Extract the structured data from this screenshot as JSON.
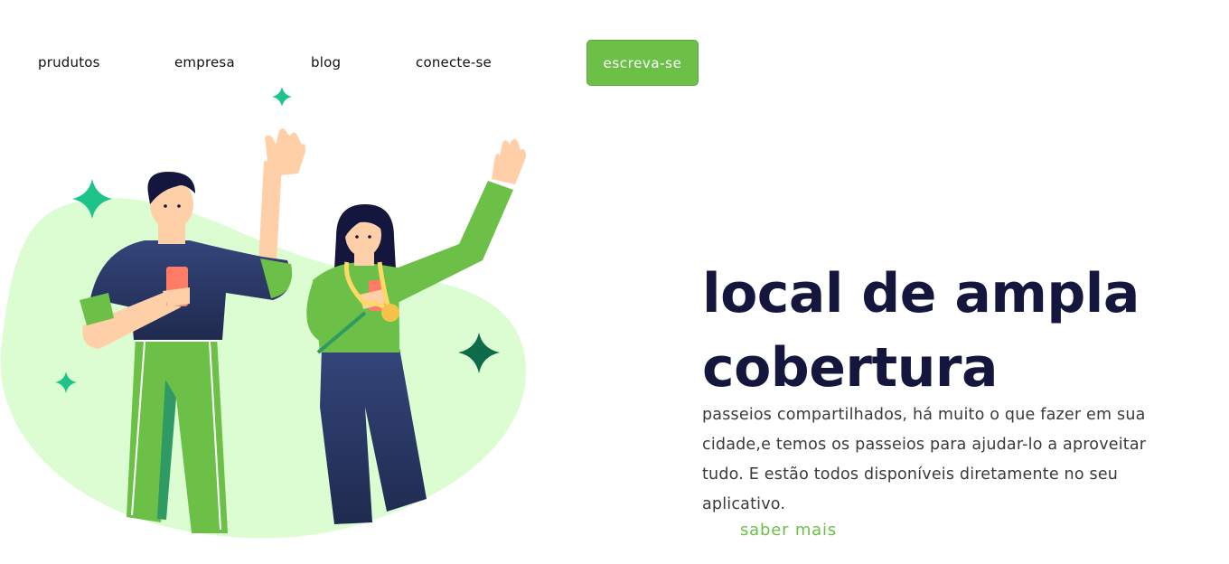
{
  "nav": {
    "items": [
      {
        "label": "prudutos"
      },
      {
        "label": "empresa"
      },
      {
        "label": "blog"
      },
      {
        "label": "conecte-se"
      }
    ],
    "cta_label": "escreva-se"
  },
  "hero": {
    "title": "local de ampla cobertura",
    "description": "passeios compartilhados, há muito o que fazer em sua cidade,e temos os passeios para ajudar-lo a aproveitar tudo. E estão todos disponíveis diretamente no seu aplicativo.",
    "link_label": "saber mais"
  },
  "colors": {
    "accent": "#6cc048",
    "title": "#14163d",
    "blob": "#dcfcd2",
    "sparkle": "#1cc48a",
    "sparkle_dark": "#0e6b4a",
    "navy": "#2b3a67"
  },
  "icons": {
    "sparkle": "four-point-star"
  }
}
